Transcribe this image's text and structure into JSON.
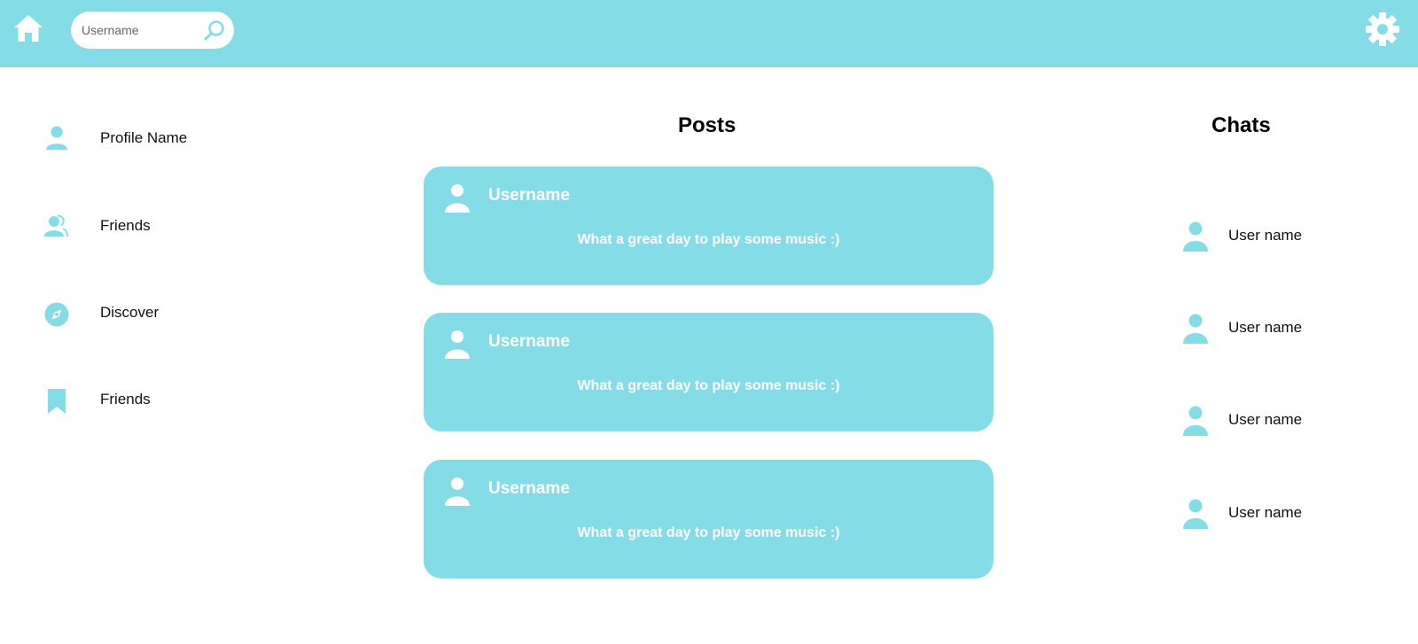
{
  "colors": {
    "accent": "#84dde6",
    "white": "#ffffff",
    "text": "#111111"
  },
  "header": {
    "home_icon": "home-icon",
    "search": {
      "placeholder": "Username",
      "value": "",
      "icon": "search-icon"
    },
    "settings_icon": "gear-icon"
  },
  "sidebar": {
    "items": [
      {
        "label": "Profile Name",
        "icon": "user-icon"
      },
      {
        "label": "Friends",
        "icon": "users-icon"
      },
      {
        "label": "Discover",
        "icon": "compass-icon"
      },
      {
        "label": "Friends",
        "icon": "bookmark-icon"
      }
    ]
  },
  "posts": {
    "title": "Posts",
    "items": [
      {
        "author": "Username",
        "text": "What a great day to play some music :)"
      },
      {
        "author": "Username",
        "text": "What a great day to play some music :)"
      },
      {
        "author": "Username",
        "text": "What a great day to play some music :)"
      }
    ]
  },
  "chats": {
    "title": "Chats",
    "items": [
      {
        "name": "User name"
      },
      {
        "name": "User name"
      },
      {
        "name": "User name"
      },
      {
        "name": "User name"
      }
    ]
  }
}
